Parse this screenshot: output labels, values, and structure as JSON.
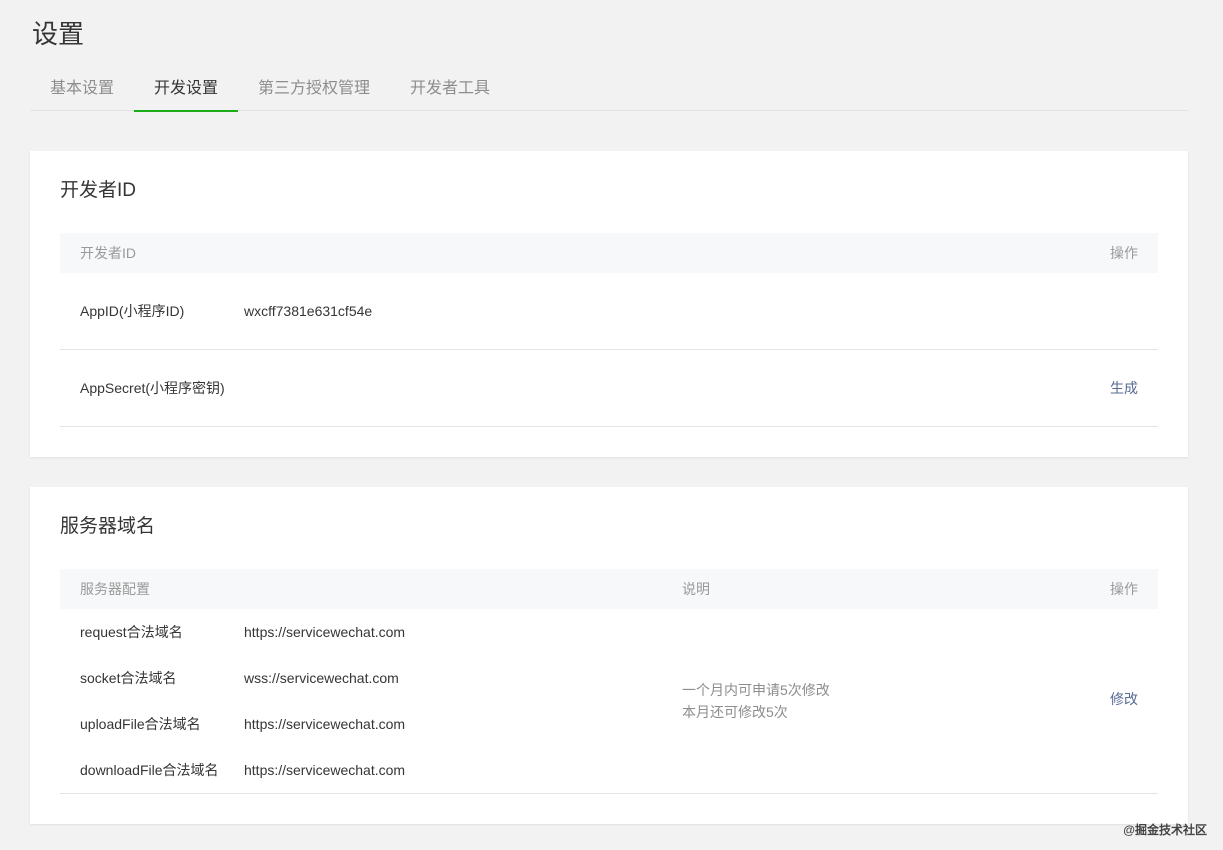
{
  "page": {
    "title": "设置"
  },
  "tabs": [
    {
      "label": "基本设置",
      "active": false
    },
    {
      "label": "开发设置",
      "active": true
    },
    {
      "label": "第三方授权管理",
      "active": false
    },
    {
      "label": "开发者工具",
      "active": false
    }
  ],
  "developer_id": {
    "title": "开发者ID",
    "header": {
      "col1": "开发者ID",
      "action": "操作"
    },
    "rows": [
      {
        "label": "AppID(小程序ID)",
        "value": "wxcff7381e631cf54e",
        "action": ""
      },
      {
        "label": "AppSecret(小程序密钥)",
        "value": "",
        "action": "生成"
      }
    ]
  },
  "server_domain": {
    "title": "服务器域名",
    "header": {
      "col1": "服务器配置",
      "col2": "说明",
      "action": "操作"
    },
    "rows": [
      {
        "label": "request合法域名",
        "value": "https://servicewechat.com"
      },
      {
        "label": "socket合法域名",
        "value": "wss://servicewechat.com"
      },
      {
        "label": "uploadFile合法域名",
        "value": "https://servicewechat.com"
      },
      {
        "label": "downloadFile合法域名",
        "value": "https://servicewechat.com"
      }
    ],
    "description": [
      "一个月内可申请5次修改",
      "本月还可修改5次"
    ],
    "action": "修改"
  },
  "watermark": "@掘金技术社区",
  "colors": {
    "accent": "#1aad19",
    "link": "#576b95",
    "background": "#f2f2f2"
  }
}
